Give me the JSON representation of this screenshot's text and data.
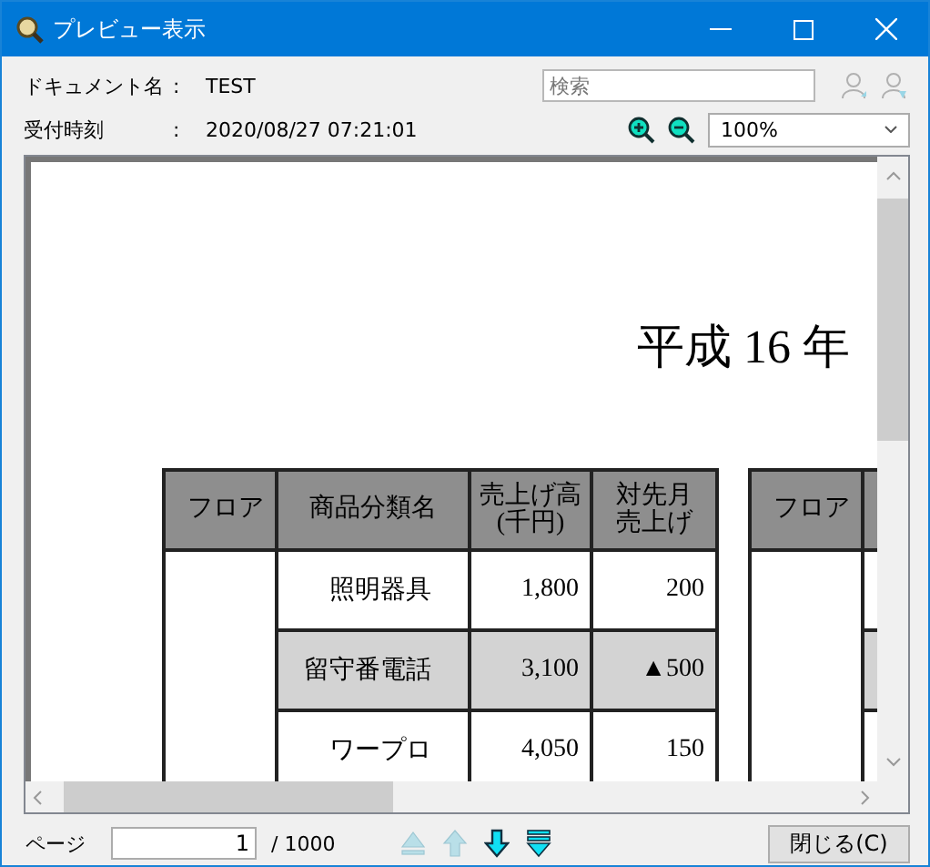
{
  "window": {
    "title": "プレビュー表示"
  },
  "info": [
    {
      "label": "ドキュメント名",
      "separator": ":",
      "value": "TEST"
    },
    {
      "label": "受付時刻",
      "separator": ":",
      "value": "2020/08/27 07:21:01"
    }
  ],
  "search": {
    "placeholder": "検索",
    "buttons": [
      {
        "kind": "find_prev",
        "disabled": true
      },
      {
        "kind": "find_next",
        "disabled": true
      }
    ]
  },
  "zoom": {
    "value": "100%"
  },
  "document": {
    "title": "平成 16 年",
    "table": {
      "columns": [
        "フロア",
        "商品分類名",
        "売上げ高(千円)",
        "対先月売上げ"
      ],
      "rows": [
        {
          "category": "照明器具",
          "sales": "1,800",
          "change": "200",
          "shaded": false
        },
        {
          "category": "留守番電話",
          "sales": "3,100",
          "change": "▲500",
          "shaded": true
        },
        {
          "category": "ワープロ",
          "sales": "4,050",
          "change": "150",
          "shaded": false
        }
      ]
    },
    "table_2": {
      "columns": [
        "フロア"
      ]
    }
  },
  "footer": {
    "page_label": "ページ",
    "page": "1",
    "total": "/ 1000",
    "nav": [
      {
        "kind": "first",
        "disabled": true
      },
      {
        "kind": "prev",
        "disabled": true
      },
      {
        "kind": "next",
        "disabled": false
      },
      {
        "kind": "last",
        "disabled": false
      }
    ],
    "close": "閉じる(C)"
  }
}
